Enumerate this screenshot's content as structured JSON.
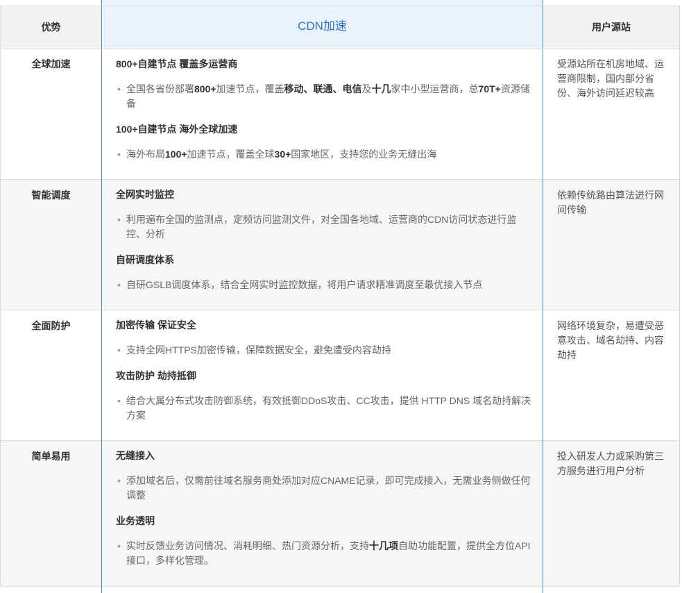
{
  "header": {
    "col_advantage": "优势",
    "col_cdn": "CDN加速",
    "col_origin": "用户源站"
  },
  "rows": [
    {
      "advantage": "全球加速",
      "features": [
        {
          "title": "800+自建节点 覆盖多运营商",
          "desc": [
            {
              "t": "全国各省份部署"
            },
            {
              "t": "800+",
              "b": true
            },
            {
              "t": "加速节点，覆盖"
            },
            {
              "t": "移动、联通、电信",
              "b": true
            },
            {
              "t": "及"
            },
            {
              "t": "十几",
              "b": true
            },
            {
              "t": "家中小型运营商，总"
            },
            {
              "t": "70T+",
              "b": true
            },
            {
              "t": "资源储备"
            }
          ]
        },
        {
          "title": "100+自建节点 海外全球加速",
          "desc": [
            {
              "t": "海外布局"
            },
            {
              "t": "100+",
              "b": true
            },
            {
              "t": "加速节点，覆盖全球"
            },
            {
              "t": "30+",
              "b": true
            },
            {
              "t": "国家地区，支持您的业务无缝出海"
            }
          ]
        }
      ],
      "origin": "受源站所在机房地域、运营商限制，国内部分省份、海外访问延迟较高"
    },
    {
      "advantage": "智能调度",
      "features": [
        {
          "title": "全网实时监控",
          "desc": [
            {
              "t": "利用遍布全国的监测点，定频访问监测文件，对全国各地域、运营商的CDN访问状态进行监控、分析"
            }
          ]
        },
        {
          "title": "自研调度体系",
          "desc": [
            {
              "t": "自研GSLB调度体系，结合全网实时监控数据，将用户请求精准调度至最优接入节点"
            }
          ]
        }
      ],
      "origin": "依赖传统路由算法进行网间传输"
    },
    {
      "advantage": "全面防护",
      "features": [
        {
          "title": "加密传输 保证安全",
          "desc": [
            {
              "t": "支持全网HTTPS加密传输，保障数据安全，避免遭受内容劫持"
            }
          ]
        },
        {
          "title": "攻击防护 劫持抵御",
          "desc": [
            {
              "t": "结合大属分布式攻击防御系统，有效抵御DDoS攻击、CC攻击，提供 HTTP DNS 域名劫持解决方案"
            }
          ]
        }
      ],
      "origin": "网络环境复杂，易遭受恶意攻击、域名劫持、内容劫持"
    },
    {
      "advantage": "简单易用",
      "features": [
        {
          "title": "无缝接入",
          "desc": [
            {
              "t": "添加域名后，仅需前往域名服务商处添加对应CNAME记录，即可完成接入，无需业务侧做任何调整"
            }
          ]
        },
        {
          "title": "业务透明",
          "desc": [
            {
              "t": "实时反馈业务访问情况、消耗明细、热门资源分析，支持"
            },
            {
              "t": "十几项",
              "b": true
            },
            {
              "t": "自助功能配置，提供全方位API接口，多样化管理。"
            }
          ]
        }
      ],
      "origin": "投入研发人力或采购第三方服务进行用户分析"
    }
  ],
  "colors": {
    "accent_blue": "#2f74c6",
    "header_mid_bg": "#eaf2fc",
    "header_side_bg": "#f2f2f2",
    "alt_row_bg": "#f6f6f6"
  }
}
